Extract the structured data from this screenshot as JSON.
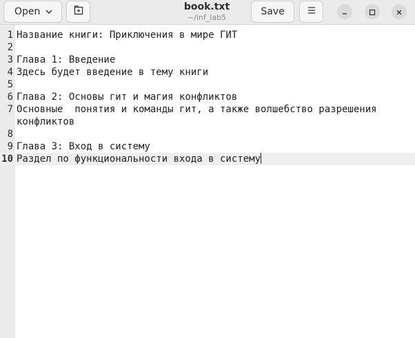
{
  "header": {
    "open_label": "Open",
    "title": "book.txt",
    "subtitle": "~/inf_lab5",
    "save_label": "Save"
  },
  "editor": {
    "lines": [
      {
        "num": "1",
        "text": "Название книги: Приключения в мире ГИТ"
      },
      {
        "num": "2",
        "text": ""
      },
      {
        "num": "3",
        "text": "Глава 1: Введение"
      },
      {
        "num": "4",
        "text": "Здесь будет введение в тему книги"
      },
      {
        "num": "5",
        "text": ""
      },
      {
        "num": "6",
        "text": "Глава 2: Основы гит и магия конфликтов"
      },
      {
        "num": "7",
        "text": "Основные  понятия и команды гит, а также волшебство разрешения"
      },
      {
        "num": "",
        "text": "конфликтов"
      },
      {
        "num": "8",
        "text": ""
      },
      {
        "num": "9",
        "text": "Глава 3: Вход в систему"
      },
      {
        "num": "10",
        "text": "Раздел по функциональности входа в систему"
      }
    ],
    "current_line": "10"
  }
}
